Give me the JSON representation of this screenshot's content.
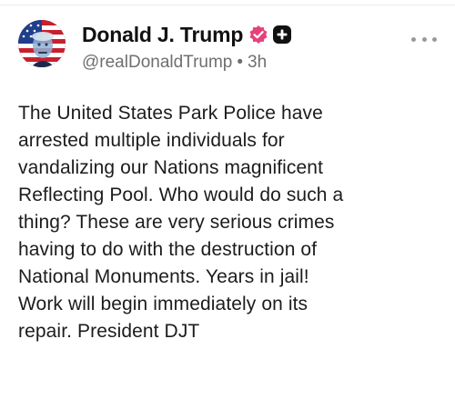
{
  "post": {
    "author": {
      "display_name": "Donald J. Trump",
      "handle": "@realDonaldTrump",
      "time_ago": "3h",
      "separator": "•",
      "avatar_icon": "flag-portrait-avatar",
      "verified_icon": "verified-badge-icon",
      "follow_icon": "plus-icon",
      "verified_color": "#e6417c"
    },
    "more_icon": "more-horizontal-icon",
    "text": "The United States Park Police have\narrested multiple individuals for\nvandalizing our Nations magnificent\nReflecting Pool. Who would do such a\nthing? These are very serious crimes\nhaving to do with the destruction of\nNational Monuments. Years in jail!\nWork will begin immediately on its\nrepair. President DJT"
  }
}
